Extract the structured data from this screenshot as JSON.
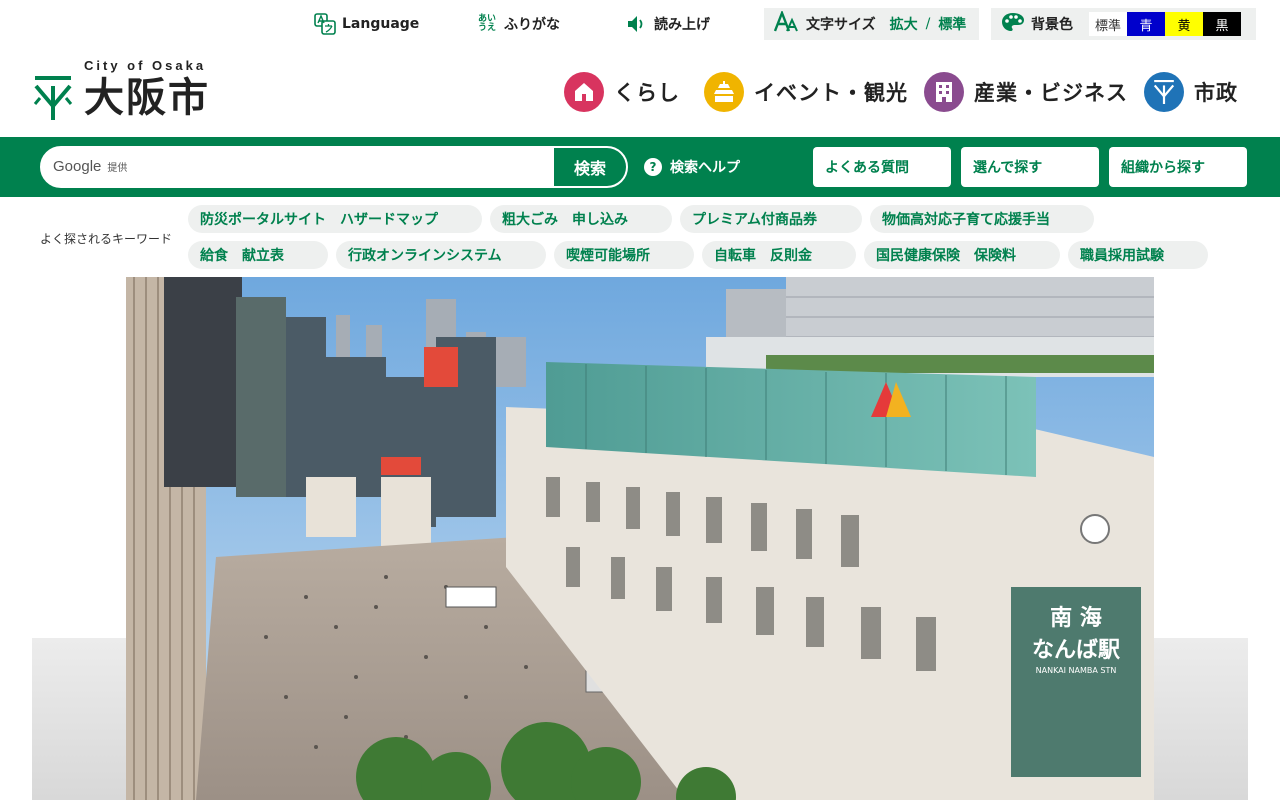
{
  "utility": {
    "language": "Language",
    "furigana_mark": "あい\nうえ",
    "furigana": "ふりがな",
    "read_aloud": "読み上げ",
    "text_size": {
      "label": "文字サイズ",
      "enlarge": "拡大",
      "separator": "/",
      "standard": "標準"
    },
    "bg_color": {
      "label": "背景色",
      "options": [
        {
          "label": "標準",
          "bg": "#ffffff",
          "fg": "#333333"
        },
        {
          "label": "青",
          "bg": "#0000cc",
          "fg": "#ffffff"
        },
        {
          "label": "黄",
          "bg": "#ffff00",
          "fg": "#000000"
        },
        {
          "label": "黒",
          "bg": "#000000",
          "fg": "#ffffff"
        }
      ]
    }
  },
  "header": {
    "logo_sub": "City of Osaka",
    "logo_main": "大阪市",
    "nav": [
      {
        "label": "くらし",
        "color": "#d8345f",
        "icon": "house-icon"
      },
      {
        "label": "イベント・観光",
        "color": "#f0b400",
        "icon": "osaka-castle-icon"
      },
      {
        "label": "産業・ビジネス",
        "color": "#8a4b8f",
        "icon": "building-icon"
      },
      {
        "label": "市政",
        "color": "#1f73b7",
        "icon": "city-emblem-icon"
      }
    ]
  },
  "search": {
    "provider": "Google",
    "provider_note": "提供",
    "button": "検索",
    "help": "検索ヘルプ",
    "help_icon": "?"
  },
  "quick_links": [
    "よくある質問",
    "選んで探す",
    "組織から探す"
  ],
  "keywords": {
    "title": "よく探されるキーワード",
    "row1": [
      "防災ポータルサイト　ハザードマップ",
      "粗大ごみ　申し込み",
      "プレミアム付商品券",
      "物価高対応子育て応援手当"
    ],
    "row2": [
      "給食　献立表",
      "行政オンラインシステム",
      "喫煙可能場所",
      "自転車　反則金",
      "国民健康保険　保険料",
      "職員採用試験"
    ]
  },
  "hero": {
    "sign_line1": "南 海",
    "sign_line2": "なんば駅",
    "sign_line3": "NANKAI NAMBA STN"
  },
  "colors": {
    "brand_green": "#00814e",
    "chip_bg": "#eef0ef"
  }
}
